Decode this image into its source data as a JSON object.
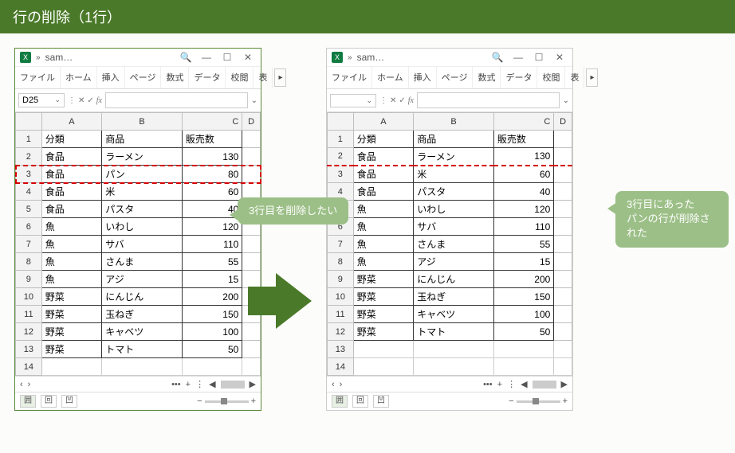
{
  "title": "行の削除（1行）",
  "callout1": "3行目を削除したい",
  "callout2": "3行目にあった\nパンの行が削除された",
  "window": {
    "filename": "sam…",
    "tabs": [
      "ファイル",
      "ホーム",
      "挿入",
      "ページ",
      "数式",
      "データ",
      "校閲",
      "表"
    ],
    "namebox_left": "D25",
    "namebox_right": "",
    "columns": [
      "A",
      "B",
      "C",
      "D"
    ]
  },
  "chart_data": {
    "type": "table",
    "headers": [
      "分類",
      "商品",
      "販売数"
    ],
    "before": [
      [
        "食品",
        "ラーメン",
        130
      ],
      [
        "食品",
        "パン",
        80
      ],
      [
        "食品",
        "米",
        60
      ],
      [
        "食品",
        "パスタ",
        40
      ],
      [
        "魚",
        "いわし",
        120
      ],
      [
        "魚",
        "サバ",
        110
      ],
      [
        "魚",
        "さんま",
        55
      ],
      [
        "魚",
        "アジ",
        15
      ],
      [
        "野菜",
        "にんじん",
        200
      ],
      [
        "野菜",
        "玉ねぎ",
        150
      ],
      [
        "野菜",
        "キャベツ",
        100
      ],
      [
        "野菜",
        "トマト",
        50
      ]
    ],
    "after": [
      [
        "食品",
        "ラーメン",
        130
      ],
      [
        "食品",
        "米",
        60
      ],
      [
        "食品",
        "パスタ",
        40
      ],
      [
        "魚",
        "いわし",
        120
      ],
      [
        "魚",
        "サバ",
        110
      ],
      [
        "魚",
        "さんま",
        55
      ],
      [
        "魚",
        "アジ",
        15
      ],
      [
        "野菜",
        "にんじん",
        200
      ],
      [
        "野菜",
        "玉ねぎ",
        150
      ],
      [
        "野菜",
        "キャベツ",
        100
      ],
      [
        "野菜",
        "トマト",
        50
      ]
    ],
    "highlight_before_row_index": 1,
    "highlight_after_between": 1
  },
  "icons": {
    "logo": "X",
    "search": "🔍",
    "min": "—",
    "max": "☐",
    "close": "✕",
    "chevron": "»",
    "dropdown": "⌄",
    "fx_cancel": "✕",
    "fx_ok": "✓",
    "fx": "fx",
    "formula_drop": "⌄",
    "sheet_left": "‹",
    "sheet_right": "›",
    "sheet_dots": "•••",
    "sheet_plus": "+",
    "scroll_l": "◀",
    "scroll_r": "▶",
    "view1": "囲",
    "view2": "回",
    "view3": "凹",
    "zoom_minus": "−",
    "zoom_plus": "+",
    "more": "▸"
  }
}
